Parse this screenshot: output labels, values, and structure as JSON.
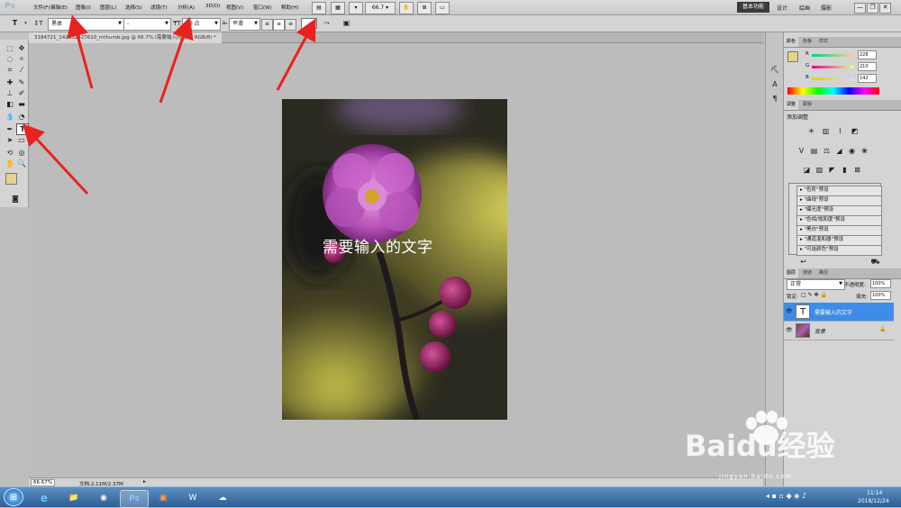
{
  "app": {
    "logo": "Ps"
  },
  "menu": [
    "文件(F)",
    "编辑(E)",
    "图像(I)",
    "图层(L)",
    "选择(S)",
    "滤镜(T)",
    "分析(A)",
    "3D(D)",
    "视图(V)",
    "窗口(W)",
    "帮助(H)"
  ],
  "menubar_controls": {
    "zoom": "66.7"
  },
  "workspaces": {
    "active": "基本功能",
    "items": [
      "设计",
      "绘画",
      "摄影"
    ]
  },
  "window_buttons": [
    "—",
    "❐",
    "✕"
  ],
  "options": {
    "tool_glyph": "T",
    "font_family": "黑体",
    "font_style": "-",
    "font_size": "60 点",
    "antialias": "平滑"
  },
  "document": {
    "tab_title": "3184721_142532427610_mthumb.jpg @ 66.7% (需要输入的文字, RGB/8) *",
    "typed_text": "需要输入的文字",
    "zoom_status": "66.67%",
    "file_status": "文档:2.11M/2.37M"
  },
  "panels": {
    "color_tabs": [
      "颜色",
      "色板",
      "样式"
    ],
    "color": {
      "r_label": "R",
      "g_label": "G",
      "b_label": "B",
      "r": "228",
      "g": "210",
      "b": "142"
    },
    "adjust_tabs": [
      "调整",
      "蒙版"
    ],
    "adjust_title": "添加调整",
    "presets": [
      "\"色阶\"预设",
      "\"曲线\"预设",
      "\"曝光度\"预设",
      "\"色相/饱和度\"预设",
      "\"黑白\"预设",
      "\"通道混和器\"预设",
      "\"可选颜色\"预设"
    ],
    "layers_tabs": [
      "图层",
      "通道",
      "路径"
    ],
    "blend_mode": "正常",
    "opacity_label": "不透明度:",
    "opacity": "100%",
    "lock_label": "锁定:",
    "fill_label": "填充:",
    "fill": "100%",
    "layers": [
      {
        "name": "需要输入的文字",
        "thumb": "T",
        "selected": true
      },
      {
        "name": "背景",
        "thumb": "",
        "selected": false
      }
    ]
  },
  "taskbar": {
    "time": "11:14",
    "date": "2018/12/24",
    "apps": [
      "ie",
      "explorer",
      "chrome",
      "Ps",
      "app-orange",
      "W",
      "cloud"
    ]
  },
  "watermark": {
    "brand": "Baidu经验",
    "url": "jingyan.baidu.com"
  },
  "colors": {
    "accent_layer": "#3d8de8",
    "foreground": "#e4d28e",
    "arrow": "#e8231f"
  }
}
